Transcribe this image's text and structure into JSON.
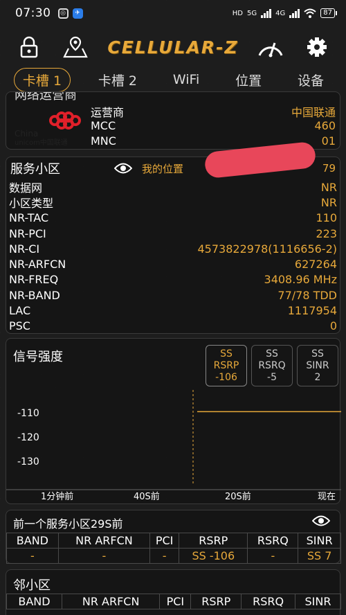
{
  "status": {
    "time": "07:30",
    "network_left": "HD",
    "network_5g": "5G",
    "network_4g": "4G",
    "battery": "87"
  },
  "toolbar": {
    "logo": "CELLULAR-Z"
  },
  "tabs": [
    "卡槽 1",
    "卡槽 2",
    "WiFi",
    "位置",
    "设备"
  ],
  "operator": {
    "partial_title": "网络运营商",
    "logo_text_top": "China",
    "logo_text_bottom": "unicom中国联通",
    "rows": [
      {
        "k": "运营商",
        "v": "中国联通"
      },
      {
        "k": "MCC",
        "v": "460"
      },
      {
        "k": "MNC",
        "v": "01"
      }
    ]
  },
  "serving": {
    "title": "服务小区",
    "my_location": "我的位置",
    "location_tail": "79",
    "rows": [
      {
        "k": "数据网",
        "v": "NR"
      },
      {
        "k": "小区类型",
        "v": "NR"
      },
      {
        "k": "NR-TAC",
        "v": "110"
      },
      {
        "k": "NR-PCI",
        "v": "223"
      },
      {
        "k": "NR-CI",
        "v": "4573822978(1116656-2)"
      },
      {
        "k": "NR-ARFCN",
        "v": "627264"
      },
      {
        "k": "NR-FREQ",
        "v": "3408.96  MHz"
      },
      {
        "k": "NR-BAND",
        "v": "77/78  TDD"
      },
      {
        "k": "LAC",
        "v": "1117954"
      },
      {
        "k": "PSC",
        "v": "0"
      }
    ]
  },
  "signal": {
    "title": "信号强度",
    "boxes": [
      {
        "l1": "SS",
        "l2": "RSRP",
        "l3": "-106"
      },
      {
        "l1": "SS",
        "l2": "RSRQ",
        "l3": "-5"
      },
      {
        "l1": "SS",
        "l2": "SINR",
        "l3": "2"
      }
    ],
    "y_ticks": [
      "-110",
      "-120",
      "-130"
    ],
    "x_ticks": [
      "1分钟前",
      "40S前",
      "20S前",
      "现在"
    ]
  },
  "prev": {
    "title": "前一个服务小区29S前",
    "headers": [
      "BAND",
      "NR  ARFCN",
      "PCI",
      "RSRP",
      "RSRQ",
      "SINR"
    ],
    "values": [
      "-",
      "-",
      "-",
      "SS  -106",
      "-",
      "SS  7"
    ]
  },
  "neighbor": {
    "title": "邻小区",
    "headers": [
      "BAND",
      "NR  ARFCN",
      "PCI",
      "RSRP",
      "RSRQ",
      "SINR"
    ]
  },
  "colors": {
    "accent": "#e8a93a",
    "redaction": "#e8475a"
  },
  "chart_data": {
    "type": "line",
    "series": [
      {
        "values": [
          -106,
          -106
        ]
      }
    ],
    "x": [
      "20S前",
      "现在"
    ],
    "ylim": [
      -136,
      -97
    ],
    "yticks": [
      -110,
      -120,
      -130
    ],
    "xticks": [
      "1分钟前",
      "40S前",
      "20S前",
      "现在"
    ],
    "grid": false
  }
}
